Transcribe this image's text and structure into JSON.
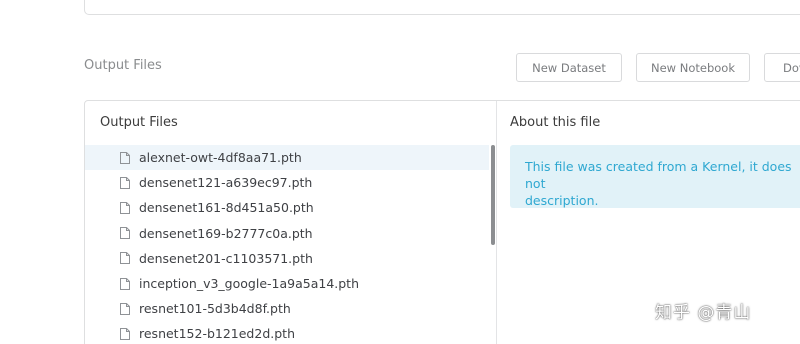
{
  "header": {
    "section_label": "Output Files",
    "buttons": {
      "new_dataset": "New Dataset",
      "new_notebook": "New Notebook",
      "download": "Dov"
    }
  },
  "files_panel": {
    "left_title": "Output Files",
    "right_title": "About this file",
    "files": [
      {
        "name": "alexnet-owt-4df8aa71.pth",
        "selected": true,
        "icon": "file-icon"
      },
      {
        "name": "densenet121-a639ec97.pth",
        "selected": false,
        "icon": "file-icon"
      },
      {
        "name": "densenet161-8d451a50.pth",
        "selected": false,
        "icon": "file-icon"
      },
      {
        "name": "densenet169-b2777c0a.pth",
        "selected": false,
        "icon": "file-icon"
      },
      {
        "name": "densenet201-c1103571.pth",
        "selected": false,
        "icon": "file-icon"
      },
      {
        "name": "inception_v3_google-1a9a5a14.pth",
        "selected": false,
        "icon": "file-icon"
      },
      {
        "name": "resnet101-5d3b4d8f.pth",
        "selected": false,
        "icon": "file-icon"
      },
      {
        "name": "resnet152-b121ed2d.pth",
        "selected": false,
        "icon": "file-icon"
      }
    ],
    "info": {
      "line1": "This file was created from a Kernel, it does not",
      "line2": "description."
    }
  },
  "watermark": "知乎 @青山",
  "colors": {
    "selected_row": "#eef5fa",
    "info_bg": "#e1f2f8",
    "info_text": "#2fa8d1"
  }
}
